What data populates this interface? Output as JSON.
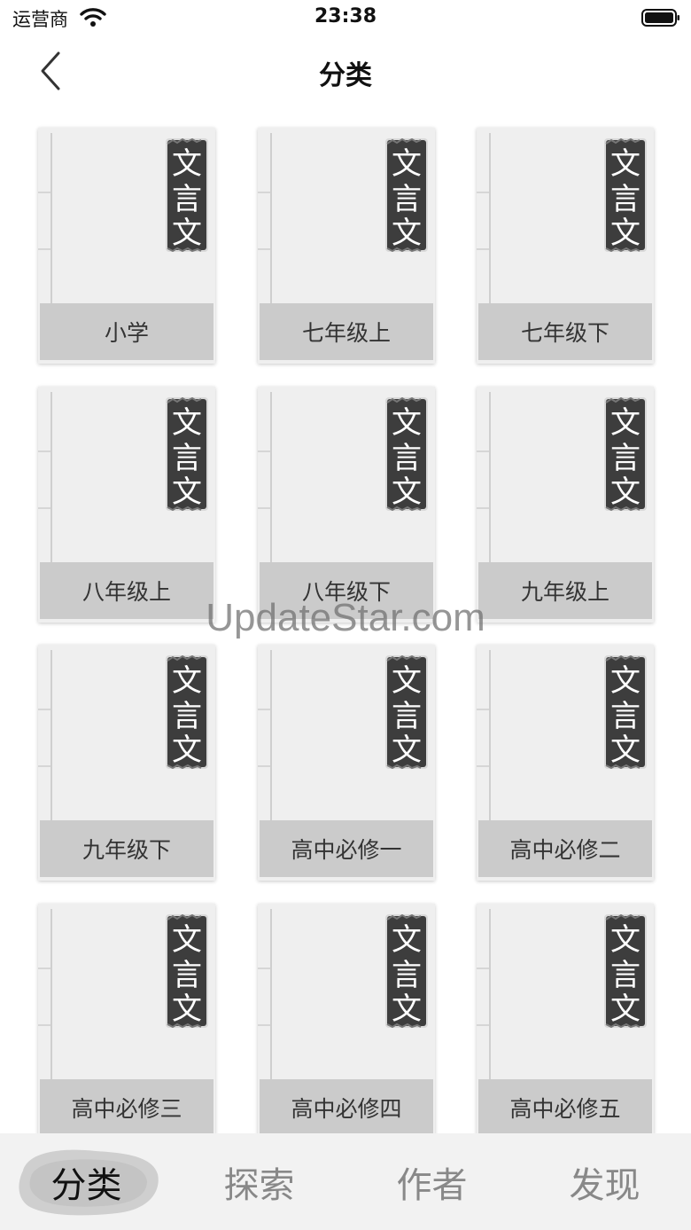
{
  "status_bar": {
    "carrier": "运营商",
    "time": "23:38"
  },
  "nav": {
    "title": "分类",
    "back_icon": "chevron-left-icon"
  },
  "cover": {
    "seal_chars": [
      "文",
      "言",
      "文"
    ]
  },
  "categories": [
    "小学",
    "七年级上",
    "七年级下",
    "八年级上",
    "八年级下",
    "九年级上",
    "九年级下",
    "高中必修一",
    "高中必修二",
    "高中必修三",
    "高中必修四",
    "高中必修五"
  ],
  "watermark": "UpdateStar.com",
  "tabs": [
    {
      "label": "分类",
      "active": true
    },
    {
      "label": "探索",
      "active": false
    },
    {
      "label": "作者",
      "active": false
    },
    {
      "label": "发现",
      "active": false
    }
  ],
  "colors": {
    "card_bg": "#efefef",
    "label_bg": "#cbcbcb",
    "seal": "#3d3d3d",
    "tab_inactive": "#888888"
  }
}
